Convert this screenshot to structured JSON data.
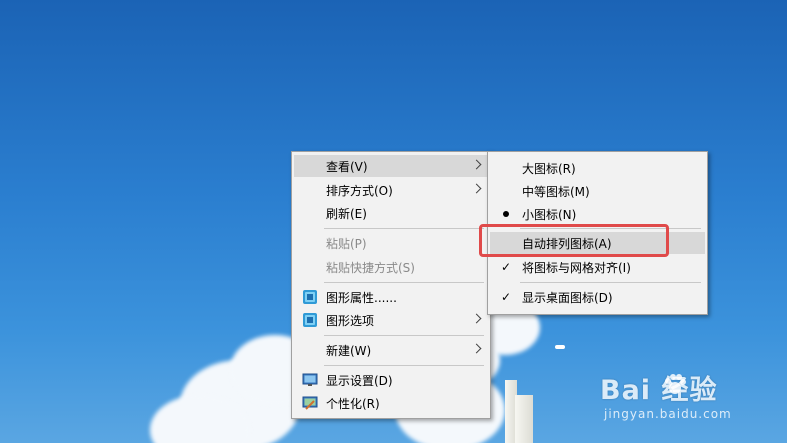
{
  "menu_main": {
    "items": [
      {
        "label": "查看(V)"
      },
      {
        "label": "排序方式(O)"
      },
      {
        "label": "刷新(E)"
      },
      {
        "label": "粘贴(P)"
      },
      {
        "label": "粘贴快捷方式(S)"
      },
      {
        "label": "图形属性......"
      },
      {
        "label": "图形选项"
      },
      {
        "label": "新建(W)"
      },
      {
        "label": "显示设置(D)"
      },
      {
        "label": "个性化(R)"
      }
    ]
  },
  "menu_view": {
    "items": [
      {
        "label": "大图标(R)"
      },
      {
        "label": "中等图标(M)"
      },
      {
        "label": "小图标(N)",
        "selected": true
      },
      {
        "label": "自动排列图标(A)",
        "checked": false
      },
      {
        "label": "将图标与网格对齐(I)",
        "checked": true
      },
      {
        "label": "显示桌面图标(D)",
        "checked": true
      }
    ]
  },
  "watermark": {
    "logo": "Bai  经验",
    "url": "jingyan.baidu.com"
  },
  "colors": {
    "highlight_box": "#e04a4a",
    "menu_bg": "#f2f2f2",
    "desktop": "#2b7fd0"
  }
}
